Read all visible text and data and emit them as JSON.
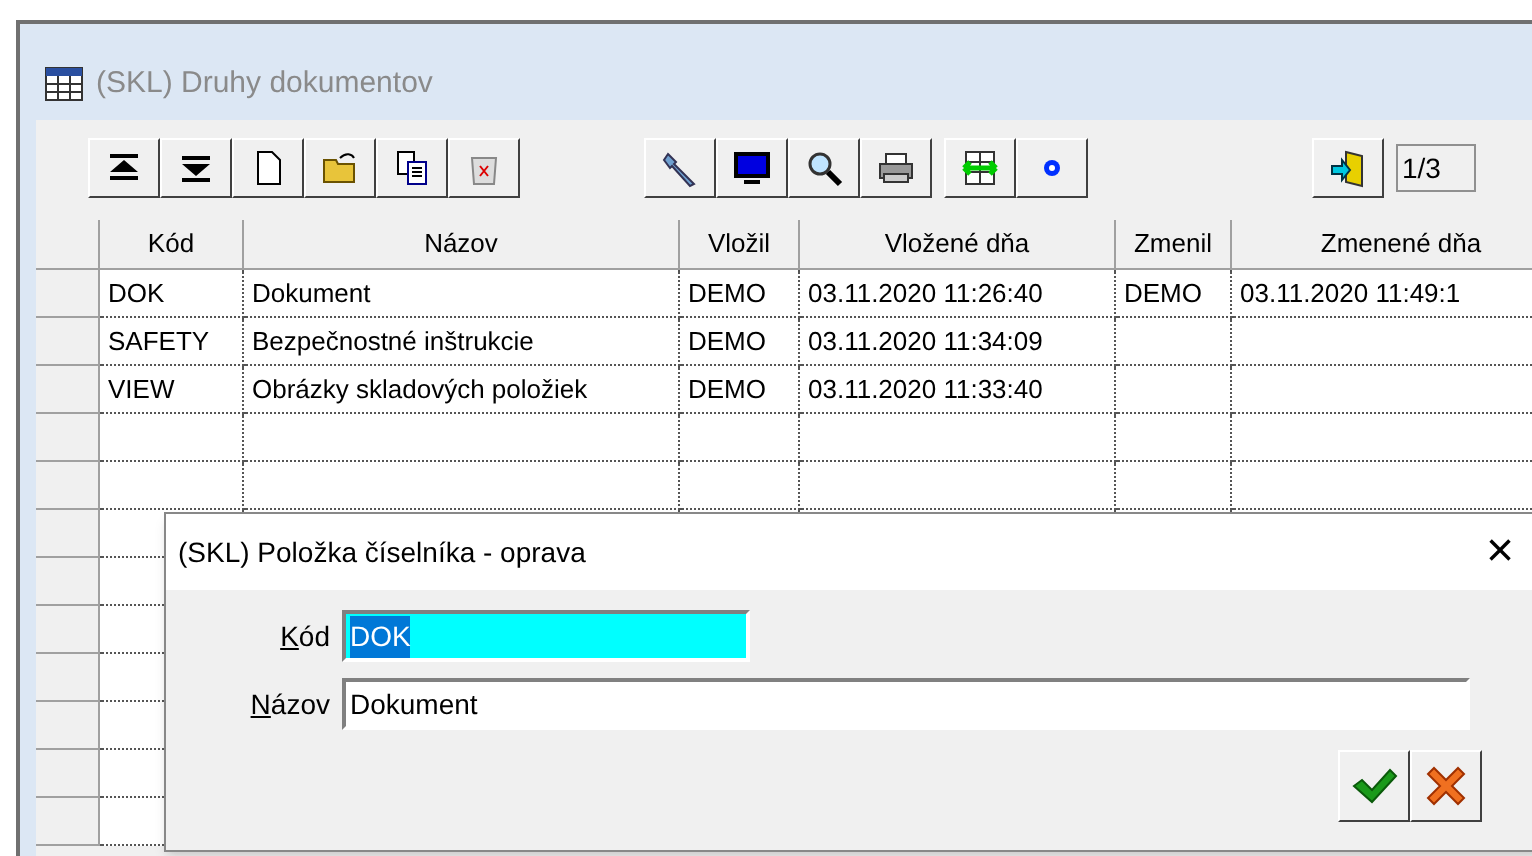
{
  "window": {
    "title": "(SKL) Druhy dokumentov"
  },
  "pager": {
    "value": "1/3"
  },
  "table": {
    "columns": [
      "Kód",
      "Názov",
      "Vložil",
      "Vložené dňa",
      "Zmenil",
      "Zmenené dňa"
    ],
    "rows": [
      [
        "DOK",
        "Dokument",
        "DEMO",
        "03.11.2020 11:26:40",
        "DEMO",
        "03.11.2020 11:49:1"
      ],
      [
        "SAFETY",
        "Bezpečnostné inštrukcie",
        "DEMO",
        "03.11.2020 11:34:09",
        "",
        ""
      ],
      [
        "VIEW",
        "Obrázky skladových položiek",
        "DEMO",
        "03.11.2020 11:33:40",
        "",
        ""
      ]
    ]
  },
  "dialog": {
    "title": "(SKL) Položka číselníka - oprava",
    "close": "×",
    "fields": [
      {
        "label": "Kód",
        "value": "DOK",
        "focused": true
      },
      {
        "label": "Názov",
        "value": "Dokument",
        "focused": false
      }
    ]
  }
}
